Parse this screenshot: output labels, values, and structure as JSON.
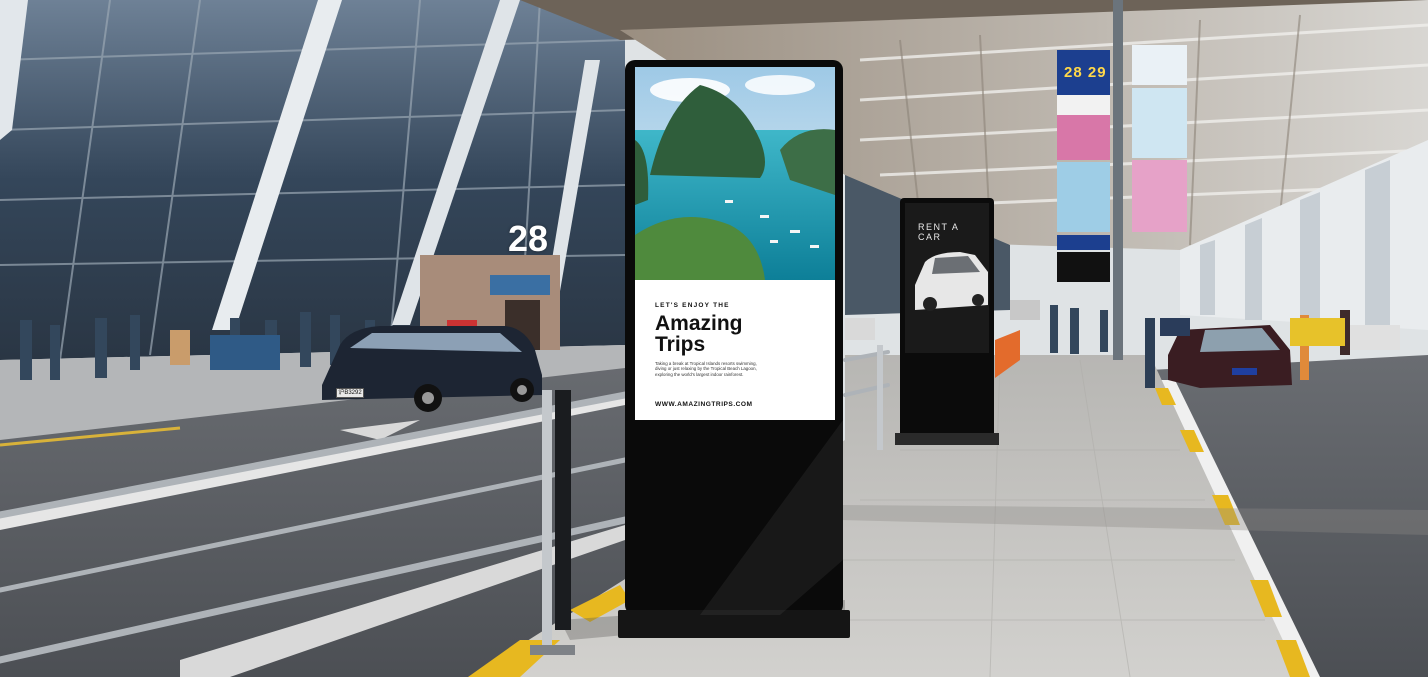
{
  "scene": {
    "colors": {
      "sky": "#dfe6ea",
      "glass": "#3b4b5c",
      "pavement": "#c9c8c5",
      "road": "#5a5d62",
      "screen_black": "#0a0a0a",
      "lane_yellow": "#e7b820",
      "sign_blue": "#1c3f8f",
      "sign_pink": "#d877a8"
    },
    "terminal_gate_number": "28",
    "overhead_sign_numbers": "28 29"
  },
  "main_kiosk": {
    "poster": {
      "kicker": "LET'S ENJOY THE",
      "headline_line1": "Amazing",
      "headline_line2": "Trips",
      "body": "Taking a break at Tropical Islands resorts swimming, diving or just relaxing by the Tropical Beach Lagoon, exploring the world's largest indoor rainforest.",
      "url": "WWW.AMAZINGTRIPS.COM"
    }
  },
  "rear_kiosk": {
    "poster": {
      "title_line1": "RENT A",
      "title_line2": "CAR"
    }
  },
  "taxi": {
    "plate": "沪B3292"
  }
}
